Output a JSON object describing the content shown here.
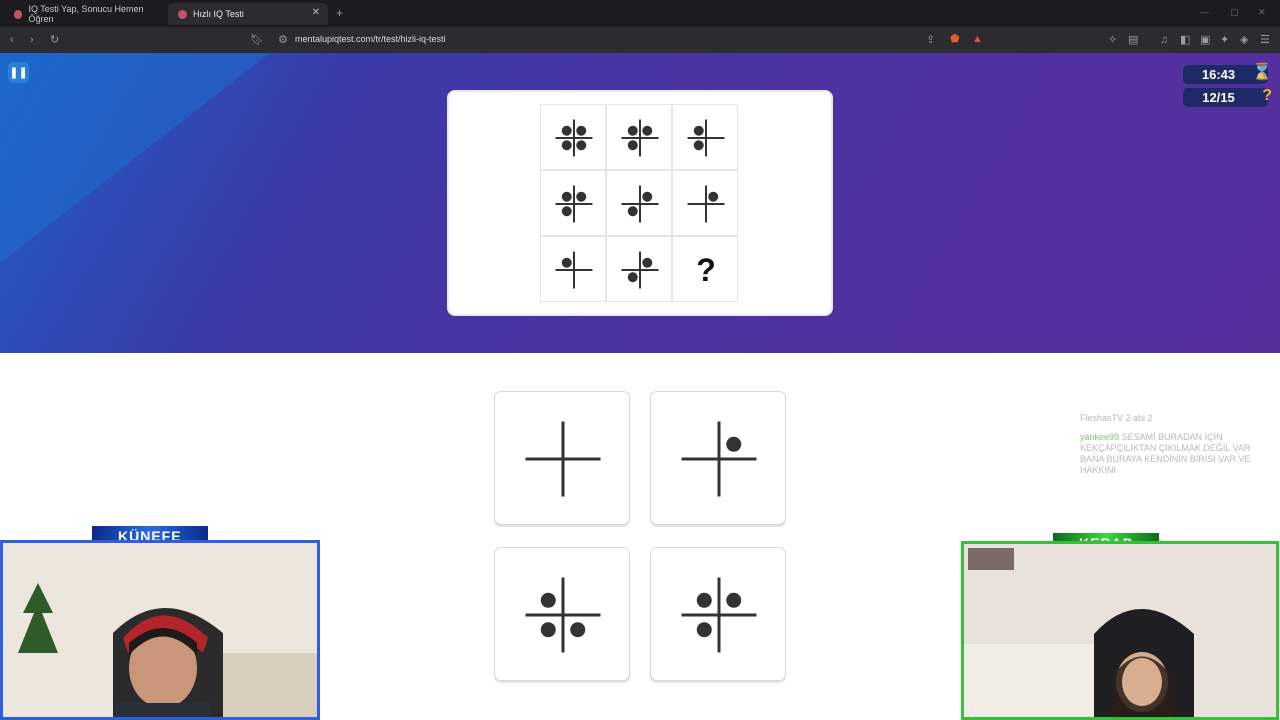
{
  "browser": {
    "tabs": [
      {
        "title": "IQ Testi Yap, Sonucu Hemen Öğren",
        "active": false
      },
      {
        "title": "Hızlı IQ Testi",
        "active": true
      }
    ],
    "url": "mentalupiqtest.com/tr/test/hizli-iq-testi"
  },
  "header": {
    "timer": "16:43",
    "progress": "12/15"
  },
  "question": {
    "missing_symbol": "?",
    "cells": [
      {
        "dots": [
          "tl",
          "tr",
          "bl",
          "br"
        ]
      },
      {
        "dots": [
          "tl",
          "tr",
          "bl"
        ]
      },
      {
        "dots": [
          "tl",
          "bl"
        ]
      },
      {
        "dots": [
          "tl",
          "tr",
          "bl"
        ]
      },
      {
        "dots": [
          "tr",
          "bl"
        ]
      },
      {
        "dots": [
          "tr"
        ]
      },
      {
        "dots": [
          "tl"
        ]
      },
      {
        "dots": [
          "tr",
          "bl"
        ]
      },
      {
        "dots": []
      }
    ]
  },
  "options": [
    {
      "dots": []
    },
    {
      "dots": [
        "tr"
      ]
    },
    {
      "dots": [
        "tl",
        "bl",
        "br"
      ]
    },
    {
      "dots": [
        "tl",
        "tr",
        "bl"
      ]
    }
  ],
  "chat": {
    "lines": [
      {
        "user": "",
        "text": "FleshasTV 2 abi 2"
      },
      {
        "user": "yankee99",
        "text": "SESAMİ BURADAN İÇİN KEKÇAPÇILIKTAN ÇIKILMAK DEĞİL VAR BANA BURAYA KENDİNİN BİRİSİ VAR VE HAKKINI"
      }
    ]
  },
  "cams": {
    "left_label": "KÜNEFE",
    "right_label": "KEBAP"
  },
  "colors": {
    "accent": "#2a7fd6",
    "left_cam_border": "#2d5fe0",
    "right_cam_border": "#37c13a"
  }
}
